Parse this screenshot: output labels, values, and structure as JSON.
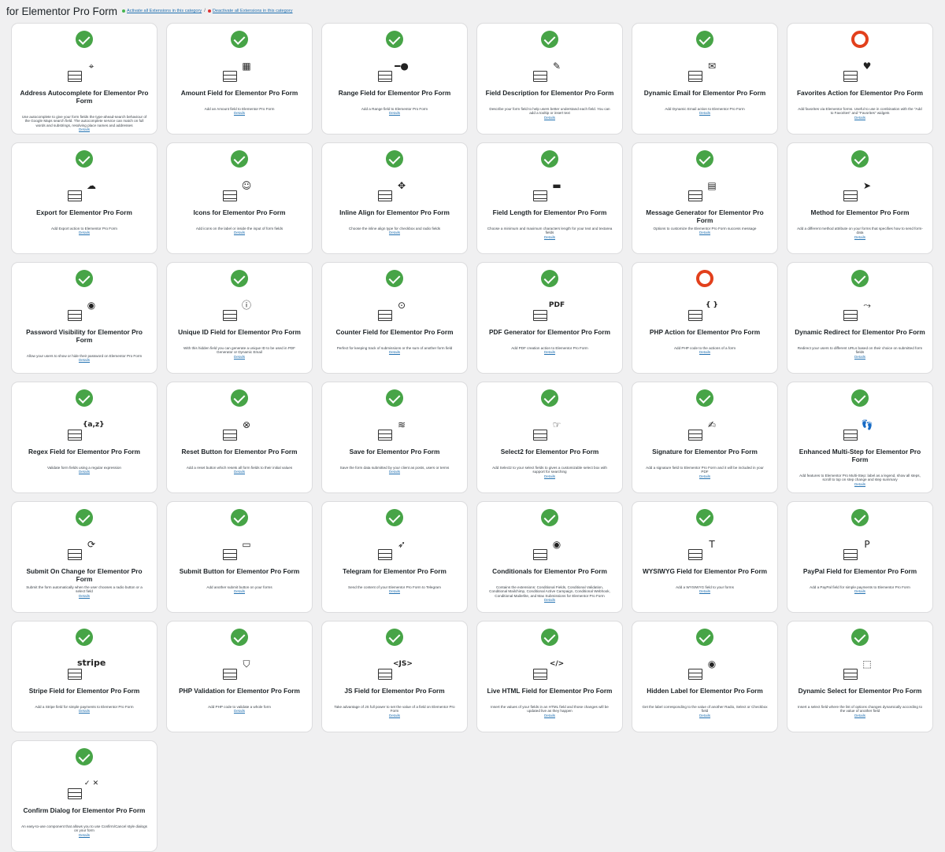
{
  "header": {
    "title": "for Elementor Pro Form",
    "activate_all": "Activate all Extensions in this category",
    "separator": "/",
    "deactivate_all": "Deactivate all Extensions in this category"
  },
  "details_label": "Details",
  "colors": {
    "active": "#47a447",
    "inactive": "#e2401c",
    "link": "#2271b1"
  },
  "extensions": [
    {
      "title": "Address Autocomplete for Elementor Pro Form",
      "desc": "Use autocomplete to give your form fields the type-ahead-search behaviour of the Google Maps search field. The autocomplete service can match on full words and substrings, resolving place names and addresses",
      "active": true,
      "icon": "map-pin-icon",
      "glyph": "⌖"
    },
    {
      "title": "Amount Field for Elementor Pro Form",
      "desc": "Add an Amount field to Elementor Pro Form",
      "active": true,
      "icon": "calculator-icon",
      "glyph": "▦"
    },
    {
      "title": "Range Field for Elementor Pro Form",
      "desc": "Add a Range field to Elementor Pro Form",
      "active": true,
      "icon": "slider-icon",
      "glyph": "━●"
    },
    {
      "title": "Field Description for Elementor Pro Form",
      "desc": "Describe your form field to help users better understand each field. You can add a tooltip or insert text",
      "active": true,
      "icon": "description-icon",
      "glyph": "✎"
    },
    {
      "title": "Dynamic Email for Elementor Pro Form",
      "desc": "Add Dynamic Email action to Elementor Pro Form",
      "active": true,
      "icon": "envelope-icon",
      "glyph": "✉"
    },
    {
      "title": "Favorites Action for Elementor Pro Form",
      "desc": "Add favorites via Elementor forms. Useful to use in combination with the \"Add to Favorites\" and \"Favorites\" widgets",
      "active": false,
      "icon": "heart-icon",
      "glyph": "♥"
    },
    {
      "title": "Export for Elementor Pro Form",
      "desc": "Add Export action to Elementor Pro Form",
      "active": true,
      "icon": "cloud-icon",
      "glyph": "☁"
    },
    {
      "title": "Icons for Elementor Pro Form",
      "desc": "Add icons on the label or inside the input of form fields",
      "active": true,
      "icon": "smiley-icon",
      "glyph": "☺"
    },
    {
      "title": "Inline Align for Elementor Pro Form",
      "desc": "Choose the inline align type for checkbox and radio fields",
      "active": true,
      "icon": "move-arrows-icon",
      "glyph": "✥"
    },
    {
      "title": "Field Length for Elementor Pro Form",
      "desc": "Choose a minimum and maximum characters length for your text and textarea fields",
      "active": true,
      "icon": "dachshund-icon",
      "glyph": "▬"
    },
    {
      "title": "Message Generator for Elementor Pro Form",
      "desc": "Options to customize the Elementor Pro Form success message",
      "active": true,
      "icon": "document-icon",
      "glyph": "▤"
    },
    {
      "title": "Method for Elementor Pro Form",
      "desc": "Add a different method attribute on your forms that specifies how to send form-data",
      "active": true,
      "icon": "paper-plane-icon",
      "glyph": "➤"
    },
    {
      "title": "Password Visibility for Elementor Pro Form",
      "desc": "Allow your users to show or hide their password on Elementor Pro Form",
      "active": true,
      "icon": "eye-icon",
      "glyph": "◉"
    },
    {
      "title": "Unique ID Field for Elementor Pro Form",
      "desc": "With this hidden field you can generate a unique ID to be used in PDF Generator or Dynamic Email",
      "active": true,
      "icon": "id-badge-icon",
      "glyph": "ⓘ"
    },
    {
      "title": "Counter Field for Elementor Pro Form",
      "desc": "Perfect for keeping track of submissions or the sum of another form field",
      "active": true,
      "icon": "counter-icon",
      "glyph": "⊙"
    },
    {
      "title": "PDF Generator for Elementor Pro Form",
      "desc": "Add PDF creation action to Elementor Pro Form",
      "active": true,
      "icon": "pdf-icon",
      "glyph": "PDF"
    },
    {
      "title": "PHP Action for Elementor Pro Form",
      "desc": "Add PHP code to the actions of a form",
      "active": false,
      "icon": "code-braces-icon",
      "glyph": "{ }"
    },
    {
      "title": "Dynamic Redirect for Elementor Pro Form",
      "desc": "Redirect your users to different URLs based on their choice on submitted form fields",
      "active": true,
      "icon": "redirect-icon",
      "glyph": "⤳"
    },
    {
      "title": "Regex Field for Elementor Pro Form",
      "desc": "Validate form fields using a regular expression",
      "active": true,
      "icon": "regex-icon",
      "glyph": "{a,z}"
    },
    {
      "title": "Reset Button for Elementor Pro Form",
      "desc": "Add a reset button which resets all form fields to their initial values",
      "active": true,
      "icon": "reset-x-icon",
      "glyph": "⊗"
    },
    {
      "title": "Save for Elementor Pro Form",
      "desc": "Save the form data submitted by your client as posts, users or terms",
      "active": true,
      "icon": "database-icon",
      "glyph": "≋"
    },
    {
      "title": "Select2 for Elementor Pro Form",
      "desc": "Add Select2 to your select fields to gives a customizable select box with support for searching",
      "active": true,
      "icon": "select-cursor-icon",
      "glyph": "☞"
    },
    {
      "title": "Signature for Elementor Pro Form",
      "desc": "Add a signature field to Elementor Pro Form and it will be included in your PDF",
      "active": true,
      "icon": "signature-icon",
      "glyph": "✍"
    },
    {
      "title": "Enhanced Multi-Step for Elementor Pro Form",
      "desc": "Add features to Elementor Pro Multi-Step: label as a legend, show all steps, scroll to top on step change and step summary",
      "active": true,
      "icon": "footsteps-icon",
      "glyph": "👣"
    },
    {
      "title": "Submit On Change for Elementor Pro Form",
      "desc": "Submit the form automatically when the user chooses a radio button or a select field",
      "active": true,
      "icon": "submit-change-icon",
      "glyph": "⟳"
    },
    {
      "title": "Submit Button for Elementor Pro Form",
      "desc": "Add another submit button on your forms",
      "active": true,
      "icon": "submit-button-icon",
      "glyph": "▭"
    },
    {
      "title": "Telegram for Elementor Pro Form",
      "desc": "Send the content of your Elementor Pro Form to Telegram",
      "active": true,
      "icon": "telegram-icon",
      "glyph": "➶"
    },
    {
      "title": "Conditionals for Elementor Pro Form",
      "desc": "Contains the extensions: Conditional Fields, Conditional Validation, Conditional Mailchimp, Conditional Active Campaign, Conditional Webhook, Conditional Mailerlite, and Max Submissions for Elementor Pro Form",
      "active": true,
      "icon": "eye-icon",
      "glyph": "◉"
    },
    {
      "title": "WYSIWYG Field for Elementor Pro Form",
      "desc": "Add a WYSIWYG field to your forms",
      "active": true,
      "icon": "text-editor-icon",
      "glyph": "T"
    },
    {
      "title": "PayPal Field for Elementor Pro Form",
      "desc": "Add a PayPal field for simple payments to Elementor Pro Form",
      "active": true,
      "icon": "paypal-icon",
      "glyph": "P"
    },
    {
      "title": "Stripe Field for Elementor Pro Form",
      "desc": "Add a Stripe field for simple payments to Elementor Pro Form",
      "active": true,
      "icon": "stripe-icon",
      "glyph": "stripe"
    },
    {
      "title": "PHP Validation for Elementor Pro Form",
      "desc": "Add PHP code to validate a whole form",
      "active": true,
      "icon": "shield-check-icon",
      "glyph": "⛉"
    },
    {
      "title": "JS Field for Elementor Pro Form",
      "desc": "Take advantage of JS full power to set the value of a field on Elementor Pro Form",
      "active": true,
      "icon": "js-icon",
      "glyph": "<JS>"
    },
    {
      "title": "Live HTML Field for Elementor Pro Form",
      "desc": "Insert the values of your fields in an HTML field and those changes will be updated live as they happen",
      "active": true,
      "icon": "live-html-icon",
      "glyph": "</>"
    },
    {
      "title": "Hidden Label for Elementor Pro Form",
      "desc": "Get the label corresponding to the value of another Radio, Select or Checkbox field",
      "active": true,
      "icon": "hidden-eye-icon",
      "glyph": "◉"
    },
    {
      "title": "Dynamic Select for Elementor Pro Form",
      "desc": "Insert a select field where the list of options changes dynamically according to the value of another field",
      "active": true,
      "icon": "cursor-select-icon",
      "glyph": "⬚"
    },
    {
      "title": "Confirm Dialog for Elementor Pro Form",
      "desc": "An easy-to-use component that allows you to use Confirm/Cancel style dialogs on your form",
      "active": true,
      "icon": "confirm-dialog-icon",
      "glyph": "✓ ✕"
    }
  ]
}
